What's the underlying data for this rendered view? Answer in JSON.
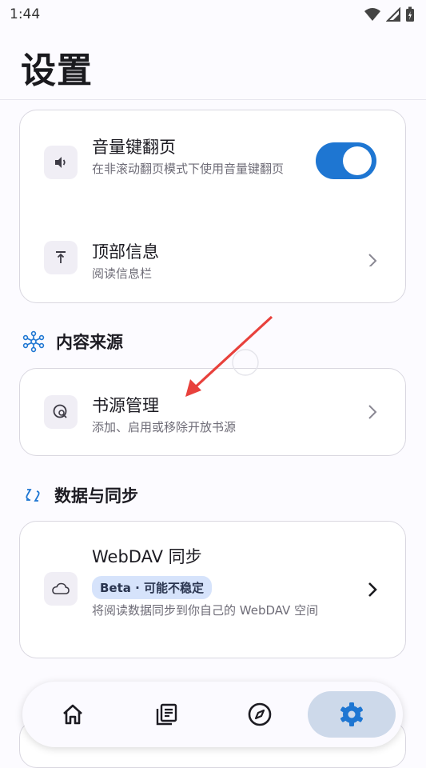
{
  "status_bar": {
    "time": "1:44"
  },
  "header": {
    "title": "设置"
  },
  "reading_card": {
    "volume_key": {
      "title": "音量键翻页",
      "subtitle": "在非滚动翻页模式下使用音量键翻页",
      "enabled": true
    },
    "top_info": {
      "title": "顶部信息",
      "subtitle": "阅读信息栏"
    }
  },
  "content_sources": {
    "section_title": "内容来源",
    "source_management": {
      "title": "书源管理",
      "subtitle": "添加、启用或移除开放书源"
    }
  },
  "data_sync": {
    "section_title": "数据与同步",
    "webdav": {
      "title": "WebDAV 同步",
      "badge": "Beta · 可能不稳定",
      "subtitle": "将阅读数据同步到你自己的 WebDAV 空间"
    }
  },
  "bottom_nav": {
    "items": [
      {
        "name": "home-icon",
        "active": false
      },
      {
        "name": "library-icon",
        "active": false
      },
      {
        "name": "compass-icon",
        "active": false
      },
      {
        "name": "settings-gear-icon",
        "active": true
      }
    ]
  },
  "colors": {
    "accent": "#1e76d2",
    "active_nav": "#cdd9ea",
    "badge_bg": "#d6e3fb",
    "annotation_arrow": "#e8413c"
  }
}
